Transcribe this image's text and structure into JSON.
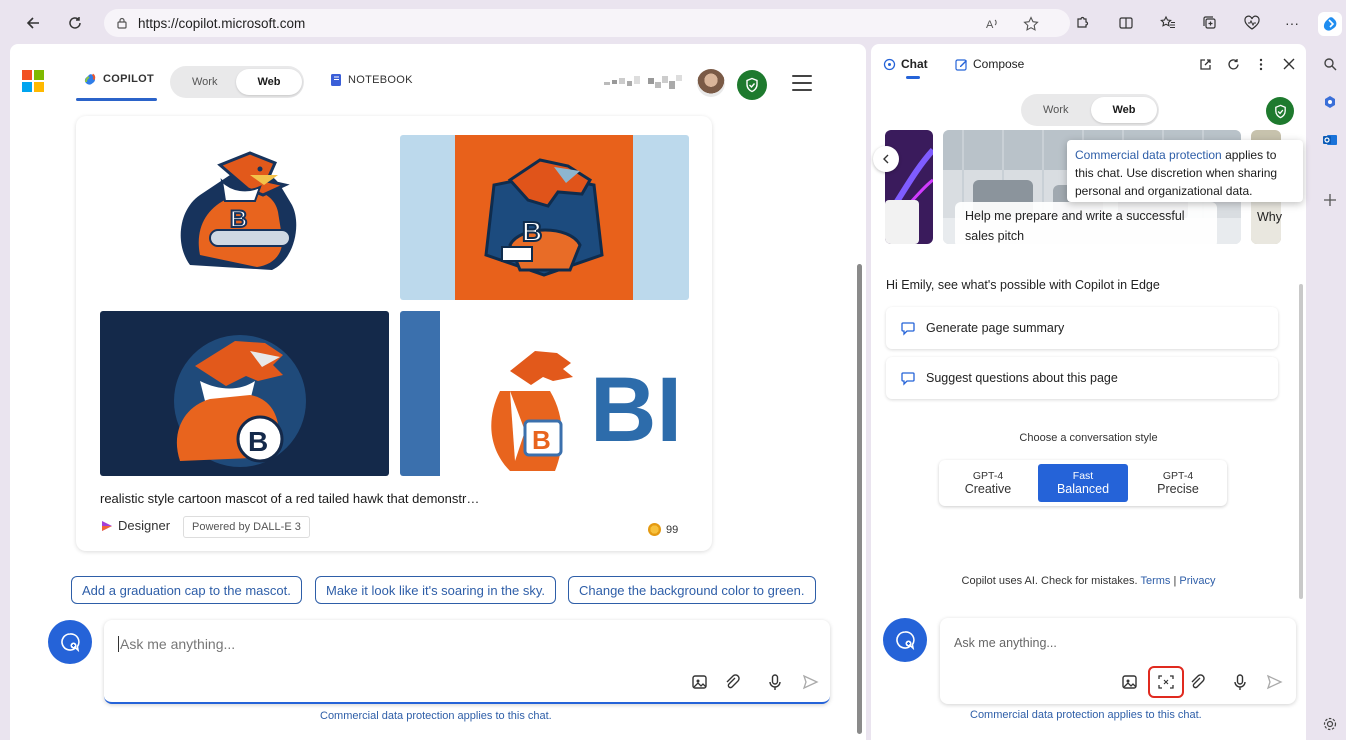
{
  "browser": {
    "url": "https://copilot.microsoft.com",
    "icons": [
      "back-icon",
      "refresh-icon",
      "lock-icon",
      "read-aloud-icon",
      "favorite-star-icon",
      "extensions-icon",
      "split-screen-icon",
      "favorites-icon",
      "collections-icon",
      "performance-icon",
      "more-icon",
      "copilot-icon"
    ],
    "more_label": "···"
  },
  "main": {
    "copilot_tab": "COPILOT",
    "work_label": "Work",
    "web_label": "Web",
    "notebook_tab": "NOTEBOOK",
    "images": [
      {
        "letter": "B",
        "bg": "#ffffff"
      },
      {
        "letter": "B",
        "bg": "#e8611b"
      },
      {
        "letter": "B",
        "bg": "#14294a"
      },
      {
        "letter": "B",
        "bg": "#ffffff"
      }
    ],
    "brand_text": "BI",
    "prompt": "realistic style cartoon mascot of a red tailed hawk that demonstr…",
    "designer_label": "Designer",
    "powered_by": "Powered by DALL-E 3",
    "boost_count": "99",
    "suggestions": [
      "Add a graduation cap to the mascot.",
      "Make it look like it's soaring in the sky.",
      "Change the background color to green."
    ],
    "input_placeholder": "Ask me anything...",
    "cdp_notice": "Commercial data protection applies to this chat."
  },
  "panel": {
    "tab_chat": "Chat",
    "tab_compose": "Compose",
    "work_label": "Work",
    "web_label": "Web",
    "carousel_caption": "Help me prepare and write a successful sales pitch",
    "carousel_next_caption": "Why",
    "tooltip_link": "Commercial data protection",
    "tooltip_rest": " applies to this chat. Use discretion when sharing personal and organizational data.",
    "greeting": "Hi Emily, see what's possible with Copilot in Edge",
    "suggestions": [
      "Generate page summary",
      "Suggest questions about this page"
    ],
    "style_label": "Choose a conversation style",
    "styles": [
      {
        "top": "GPT-4",
        "bottom": "Creative",
        "active": false
      },
      {
        "top": "Fast",
        "bottom": "Balanced",
        "active": true
      },
      {
        "top": "GPT-4",
        "bottom": "Precise",
        "active": false
      }
    ],
    "disclaimer_text": "Copilot uses AI. Check for mistakes. ",
    "terms": "Terms",
    "separator": " | ",
    "privacy": "Privacy",
    "input_placeholder": "Ask me anything...",
    "cdp_notice": "Commercial data protection applies to this chat."
  },
  "colors": {
    "accent": "#2563d8",
    "shield_green": "#1e7a2e",
    "link_blue": "#2e5ea8",
    "highlight_red": "#e02a1f"
  }
}
